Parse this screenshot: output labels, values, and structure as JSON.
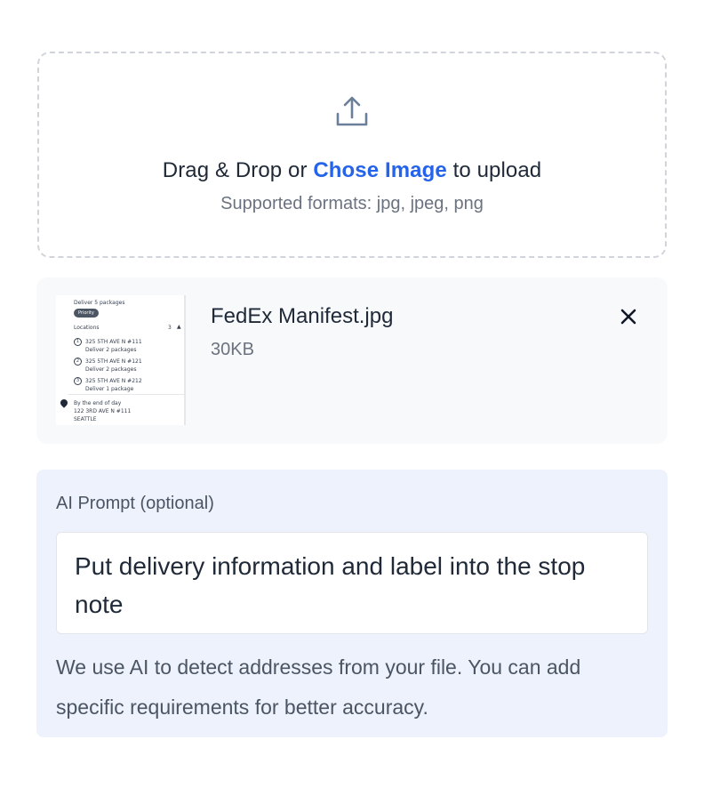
{
  "upload": {
    "icon": "upload-icon",
    "drag_text": "Drag & Drop or ",
    "choose_link": "Chose Image",
    "suffix_text": " to upload",
    "formats": "Supported formats: jpg, jpeg, png"
  },
  "file": {
    "name": "FedEx Manifest.jpg",
    "size": "30KB",
    "close_icon": "close-icon",
    "thumbnail": {
      "line1": "Deliver 5 packages",
      "badge": "Priority",
      "section": "Locations",
      "count": "3",
      "stops": [
        {
          "num": "1",
          "address": "325 5TH AVE N #111",
          "note": "Deliver 2 packages"
        },
        {
          "num": "2",
          "address": "325 5TH AVE N #121",
          "note": "Deliver 2 packages"
        },
        {
          "num": "3",
          "address": "325 5TH AVE N #212",
          "note": "Deliver 1 package"
        }
      ],
      "footer_time": "By the end of day",
      "footer_address": "122 3RD AVE N #111",
      "footer_city": "SEATTLE"
    }
  },
  "prompt": {
    "label": "AI Prompt (optional)",
    "value": "Put delivery information and label into the stop note",
    "help": "We use AI to detect addresses from your file. You can add specific requirements for better accuracy."
  },
  "colors": {
    "accent": "#2563eb",
    "panel_bg": "#eef2fd",
    "card_bg": "#f8f9fb",
    "border_dashed": "#d1d5db"
  }
}
